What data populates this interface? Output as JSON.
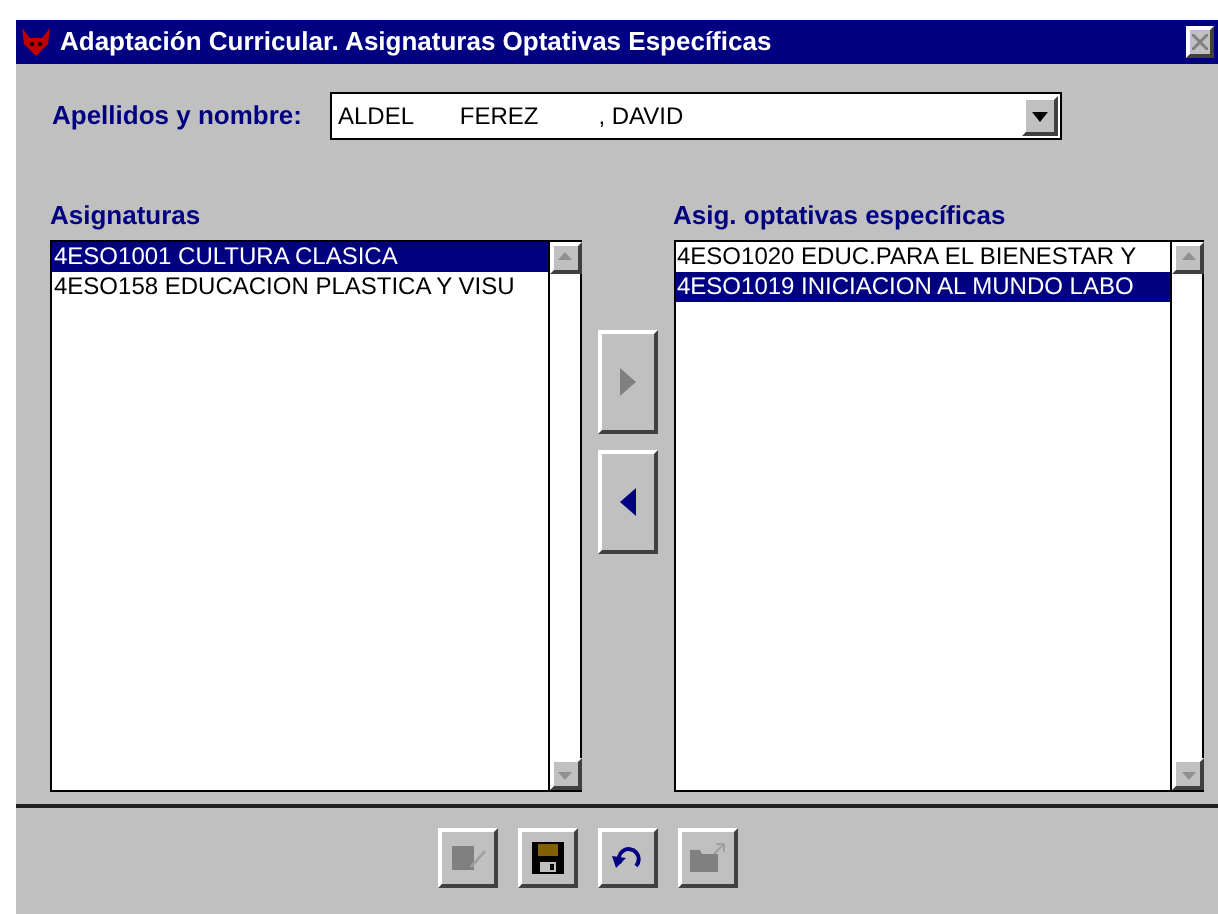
{
  "window": {
    "title": "Adaptación Curricular. Asignaturas Optativas Específicas"
  },
  "student": {
    "label": "Apellidos y nombre:",
    "value": "ALDEL       FEREZ         , DAVID"
  },
  "subjects": {
    "label": "Asignaturas",
    "items": [
      {
        "text": "4ESO1001 CULTURA CLASICA",
        "selected": true
      },
      {
        "text": "4ESO158  EDUCACION PLASTICA Y VISU",
        "selected": false
      }
    ]
  },
  "move_buttons": [
    {
      "kind": "right",
      "disabled": true
    },
    {
      "kind": "left",
      "disabled": false
    }
  ],
  "optional": {
    "label": "Asig. optativas específicas",
    "items": [
      {
        "text": "4ESO1020 EDUC.PARA EL BIENESTAR Y",
        "selected": false
      },
      {
        "text": "4ESO1019 INICIACION AL MUNDO LABO",
        "selected": true
      }
    ]
  },
  "toolbar": [
    {
      "kind": "edit",
      "disabled": true
    },
    {
      "kind": "save",
      "disabled": false
    },
    {
      "kind": "undo",
      "disabled": false
    },
    {
      "kind": "folder",
      "disabled": true
    }
  ]
}
